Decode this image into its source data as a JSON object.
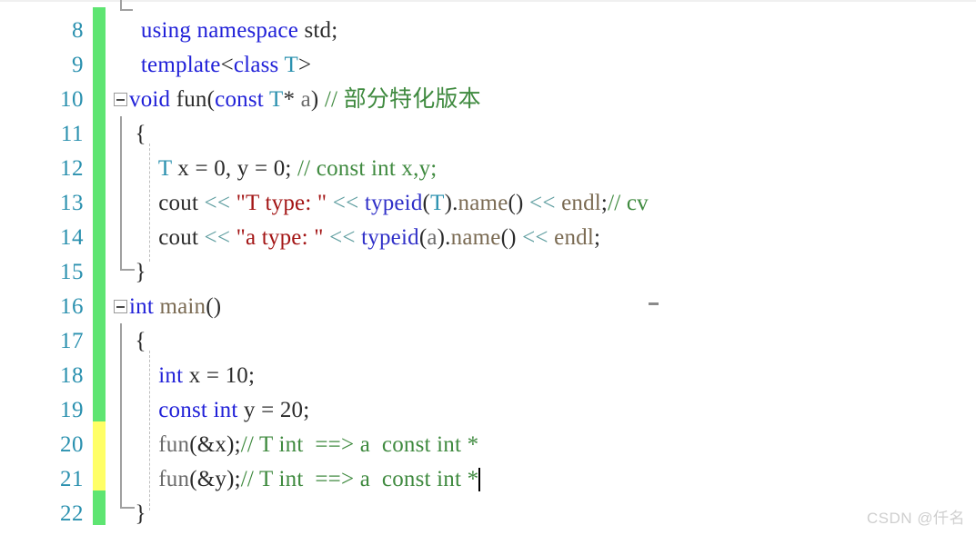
{
  "editor": {
    "type": "code-editor",
    "language": "C++",
    "watermark": "CSDN @仟名",
    "colors": {
      "line_number": "#2b91af",
      "change_bar_saved": "#5ee572",
      "change_bar_unsaved": "#ffff66",
      "keyword": "#2020d8",
      "comment": "#3f8a3f",
      "string": "#a31515",
      "type": "#2b91af",
      "background": "#ffffff"
    },
    "first_visible_line": 8,
    "last_visible_line": 22,
    "caret_line": 21
  },
  "lines": [
    {
      "number": "8",
      "change_state": "saved",
      "fold": null,
      "text": "  using namespace std;",
      "tokens": [
        {
          "text": "  ",
          "cls": "t-plain"
        },
        {
          "text": "using",
          "cls": "t-kw"
        },
        {
          "text": " ",
          "cls": "t-plain"
        },
        {
          "text": "namespace",
          "cls": "t-kw"
        },
        {
          "text": " ",
          "cls": "t-plain"
        },
        {
          "text": "std",
          "cls": "t-plain"
        },
        {
          "text": ";",
          "cls": "t-plain"
        }
      ]
    },
    {
      "number": "9",
      "change_state": "saved",
      "fold": null,
      "text": "  template<class T>",
      "tokens": [
        {
          "text": "  ",
          "cls": "t-plain"
        },
        {
          "text": "template",
          "cls": "t-kw"
        },
        {
          "text": "<",
          "cls": "t-plain"
        },
        {
          "text": "class",
          "cls": "t-kw"
        },
        {
          "text": " ",
          "cls": "t-plain"
        },
        {
          "text": "T",
          "cls": "t-type"
        },
        {
          "text": ">",
          "cls": "t-plain"
        }
      ]
    },
    {
      "number": "10",
      "change_state": "saved",
      "fold": "minus",
      "text": "void fun(const T* a) // 部分特化版本",
      "tokens": [
        {
          "text": "void",
          "cls": "t-kw"
        },
        {
          "text": " ",
          "cls": "t-plain"
        },
        {
          "text": "fun",
          "cls": "t-plain"
        },
        {
          "text": "(",
          "cls": "t-plain"
        },
        {
          "text": "const",
          "cls": "t-kw"
        },
        {
          "text": " ",
          "cls": "t-plain"
        },
        {
          "text": "T",
          "cls": "t-type"
        },
        {
          "text": "* ",
          "cls": "t-plain"
        },
        {
          "text": "a",
          "cls": "t-ident"
        },
        {
          "text": ") ",
          "cls": "t-plain"
        },
        {
          "text": "// 部分特化版本",
          "cls": "t-comment"
        }
      ]
    },
    {
      "number": "11",
      "change_state": "saved",
      "fold": null,
      "text": " {",
      "tokens": [
        {
          "text": " {",
          "cls": "t-plain"
        }
      ]
    },
    {
      "number": "12",
      "change_state": "saved",
      "fold": null,
      "text": "     T x = 0, y = 0; // const int x,y;",
      "tokens": [
        {
          "text": "     ",
          "cls": "t-plain"
        },
        {
          "text": "T",
          "cls": "t-type"
        },
        {
          "text": " x = ",
          "cls": "t-plain"
        },
        {
          "text": "0",
          "cls": "t-num"
        },
        {
          "text": ", y = ",
          "cls": "t-plain"
        },
        {
          "text": "0",
          "cls": "t-num"
        },
        {
          "text": "; ",
          "cls": "t-plain"
        },
        {
          "text": "// const int x,y;",
          "cls": "t-comment"
        }
      ]
    },
    {
      "number": "13",
      "change_state": "saved",
      "fold": null,
      "text": "     cout << \"T type: \" << typeid(T).name() << endl;// cv",
      "tokens": [
        {
          "text": "     cout ",
          "cls": "t-plain"
        },
        {
          "text": "<<",
          "cls": "t-op"
        },
        {
          "text": " ",
          "cls": "t-plain"
        },
        {
          "text": "\"T type: \"",
          "cls": "t-string"
        },
        {
          "text": " ",
          "cls": "t-plain"
        },
        {
          "text": "<<",
          "cls": "t-op"
        },
        {
          "text": " ",
          "cls": "t-plain"
        },
        {
          "text": "typeid",
          "cls": "t-call"
        },
        {
          "text": "(",
          "cls": "t-plain"
        },
        {
          "text": "T",
          "cls": "t-type"
        },
        {
          "text": ").",
          "cls": "t-plain"
        },
        {
          "text": "name",
          "cls": "t-fn"
        },
        {
          "text": "() ",
          "cls": "t-plain"
        },
        {
          "text": "<<",
          "cls": "t-op"
        },
        {
          "text": " ",
          "cls": "t-plain"
        },
        {
          "text": "endl",
          "cls": "t-fn"
        },
        {
          "text": ";",
          "cls": "t-plain"
        },
        {
          "text": "// cv",
          "cls": "t-comment"
        }
      ]
    },
    {
      "number": "14",
      "change_state": "saved",
      "fold": null,
      "text": "     cout << \"a type: \" << typeid(a).name() << endl;",
      "tokens": [
        {
          "text": "     cout ",
          "cls": "t-plain"
        },
        {
          "text": "<<",
          "cls": "t-op"
        },
        {
          "text": " ",
          "cls": "t-plain"
        },
        {
          "text": "\"a type: \"",
          "cls": "t-string"
        },
        {
          "text": " ",
          "cls": "t-plain"
        },
        {
          "text": "<<",
          "cls": "t-op"
        },
        {
          "text": " ",
          "cls": "t-plain"
        },
        {
          "text": "typeid",
          "cls": "t-call"
        },
        {
          "text": "(",
          "cls": "t-plain"
        },
        {
          "text": "a",
          "cls": "t-ident"
        },
        {
          "text": ").",
          "cls": "t-plain"
        },
        {
          "text": "name",
          "cls": "t-fn"
        },
        {
          "text": "() ",
          "cls": "t-plain"
        },
        {
          "text": "<<",
          "cls": "t-op"
        },
        {
          "text": " ",
          "cls": "t-plain"
        },
        {
          "text": "endl",
          "cls": "t-fn"
        },
        {
          "text": ";",
          "cls": "t-plain"
        }
      ]
    },
    {
      "number": "15",
      "change_state": "saved",
      "fold": null,
      "text": " }",
      "tokens": [
        {
          "text": " }",
          "cls": "t-plain"
        }
      ]
    },
    {
      "number": "16",
      "change_state": "saved",
      "fold": "minus",
      "text": "int main()",
      "tokens": [
        {
          "text": "int",
          "cls": "t-kw"
        },
        {
          "text": " ",
          "cls": "t-plain"
        },
        {
          "text": "main",
          "cls": "t-fn"
        },
        {
          "text": "()",
          "cls": "t-plain"
        }
      ]
    },
    {
      "number": "17",
      "change_state": "saved",
      "fold": null,
      "text": " {",
      "tokens": [
        {
          "text": " {",
          "cls": "t-plain"
        }
      ]
    },
    {
      "number": "18",
      "change_state": "saved",
      "fold": null,
      "text": "     int x = 10;",
      "tokens": [
        {
          "text": "     ",
          "cls": "t-plain"
        },
        {
          "text": "int",
          "cls": "t-kw"
        },
        {
          "text": " x = ",
          "cls": "t-plain"
        },
        {
          "text": "10",
          "cls": "t-num"
        },
        {
          "text": ";",
          "cls": "t-plain"
        }
      ]
    },
    {
      "number": "19",
      "change_state": "saved",
      "fold": null,
      "text": "     const int y = 20;",
      "tokens": [
        {
          "text": "     ",
          "cls": "t-plain"
        },
        {
          "text": "const",
          "cls": "t-kw"
        },
        {
          "text": " ",
          "cls": "t-plain"
        },
        {
          "text": "int",
          "cls": "t-kw"
        },
        {
          "text": " y = ",
          "cls": "t-plain"
        },
        {
          "text": "20",
          "cls": "t-num"
        },
        {
          "text": ";",
          "cls": "t-plain"
        }
      ]
    },
    {
      "number": "20",
      "change_state": "unsaved",
      "fold": null,
      "text": "     fun(&x);// T int  ==> a  const int *",
      "tokens": [
        {
          "text": "     ",
          "cls": "t-plain"
        },
        {
          "text": "fun",
          "cls": "t-ident"
        },
        {
          "text": "(&",
          "cls": "t-plain"
        },
        {
          "text": "x",
          "cls": "t-plain"
        },
        {
          "text": ");",
          "cls": "t-plain"
        },
        {
          "text": "// T int  ==> a  const int *",
          "cls": "t-comment"
        }
      ]
    },
    {
      "number": "21",
      "change_state": "unsaved",
      "fold": null,
      "text": "     fun(&y);// T int  ==> a  const int *",
      "tokens": [
        {
          "text": "     ",
          "cls": "t-plain"
        },
        {
          "text": "fun",
          "cls": "t-ident"
        },
        {
          "text": "(&",
          "cls": "t-plain"
        },
        {
          "text": "y",
          "cls": "t-plain"
        },
        {
          "text": ");",
          "cls": "t-plain"
        },
        {
          "text": "// T int  ==> a  const int *",
          "cls": "t-comment"
        }
      ]
    },
    {
      "number": "22",
      "change_state": "saved",
      "fold": null,
      "text": " }",
      "tokens": [
        {
          "text": " }",
          "cls": "t-plain"
        }
      ]
    }
  ]
}
